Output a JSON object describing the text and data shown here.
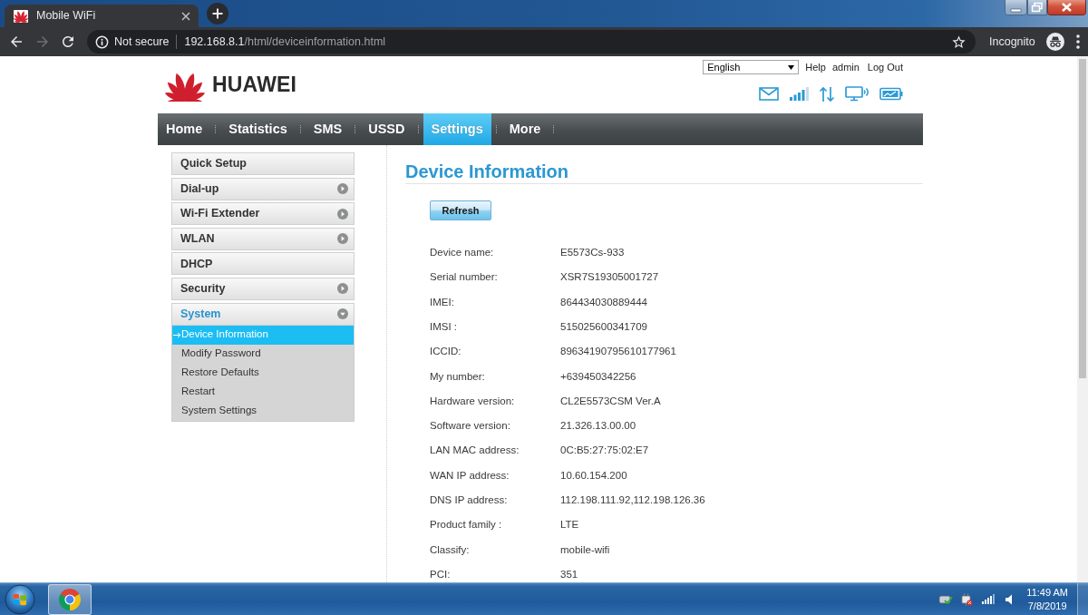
{
  "browser": {
    "tab": {
      "title": "Mobile WiFi"
    },
    "forward_disabled": true,
    "address": {
      "security": "Not secure",
      "host": "192.168.8.1",
      "path": "/html/deviceinformation.html"
    },
    "profile": "Incognito"
  },
  "header": {
    "logo_text": "HUAWEI",
    "language": "English",
    "help": "Help",
    "user": "admin",
    "logout": "Log Out"
  },
  "nav": [
    {
      "label": "Home",
      "selected": false
    },
    {
      "label": "Statistics",
      "selected": false
    },
    {
      "label": "SMS",
      "selected": false
    },
    {
      "label": "USSD",
      "selected": false
    },
    {
      "label": "Settings",
      "selected": true
    },
    {
      "label": "More",
      "selected": false
    }
  ],
  "sidebar": [
    {
      "label": "Quick Setup",
      "kind": "link",
      "selected": false
    },
    {
      "label": "Dial-up",
      "kind": "group",
      "selected": false,
      "expanded": false
    },
    {
      "label": "Wi-Fi Extender",
      "kind": "group",
      "selected": false,
      "expanded": false
    },
    {
      "label": "WLAN",
      "kind": "group",
      "selected": false,
      "expanded": false
    },
    {
      "label": "DHCP",
      "kind": "link",
      "selected": false
    },
    {
      "label": "Security",
      "kind": "group",
      "selected": false,
      "expanded": false
    },
    {
      "label": "System",
      "kind": "group",
      "selected": true,
      "expanded": true,
      "children": [
        {
          "label": "Device Information",
          "selected": true
        },
        {
          "label": "Modify Password",
          "selected": false
        },
        {
          "label": "Restore Defaults",
          "selected": false
        },
        {
          "label": "Restart",
          "selected": false
        },
        {
          "label": "System Settings",
          "selected": false
        }
      ]
    }
  ],
  "content": {
    "title": "Device Information",
    "refresh": "Refresh",
    "fields": [
      {
        "label": "Device name:",
        "value": "E5573Cs-933"
      },
      {
        "label": "Serial number:",
        "value": "XSR7S19305001727"
      },
      {
        "label": "IMEI:",
        "value": "864434030889444"
      },
      {
        "label": "IMSI :",
        "value": "515025600341709"
      },
      {
        "label": "ICCID:",
        "value": "89634190795610177961"
      },
      {
        "label": "My number:",
        "value": "+639450342256"
      },
      {
        "label": "Hardware version:",
        "value": "CL2E5573CSM Ver.A"
      },
      {
        "label": "Software version:",
        "value": "21.326.13.00.00"
      },
      {
        "label": "LAN MAC address:",
        "value": "0C:B5:27:75:02:E7"
      },
      {
        "label": "WAN IP address:",
        "value": "10.60.154.200"
      },
      {
        "label": "DNS IP address:",
        "value": "112.198.111.92,112.198.126.36"
      },
      {
        "label": "Product family :",
        "value": "LTE"
      },
      {
        "label": "Classify:",
        "value": "mobile-wifi"
      },
      {
        "label": "PCI:",
        "value": "351"
      }
    ]
  },
  "taskbar": {
    "time": "11:49 AM",
    "date": "7/8/2019"
  }
}
